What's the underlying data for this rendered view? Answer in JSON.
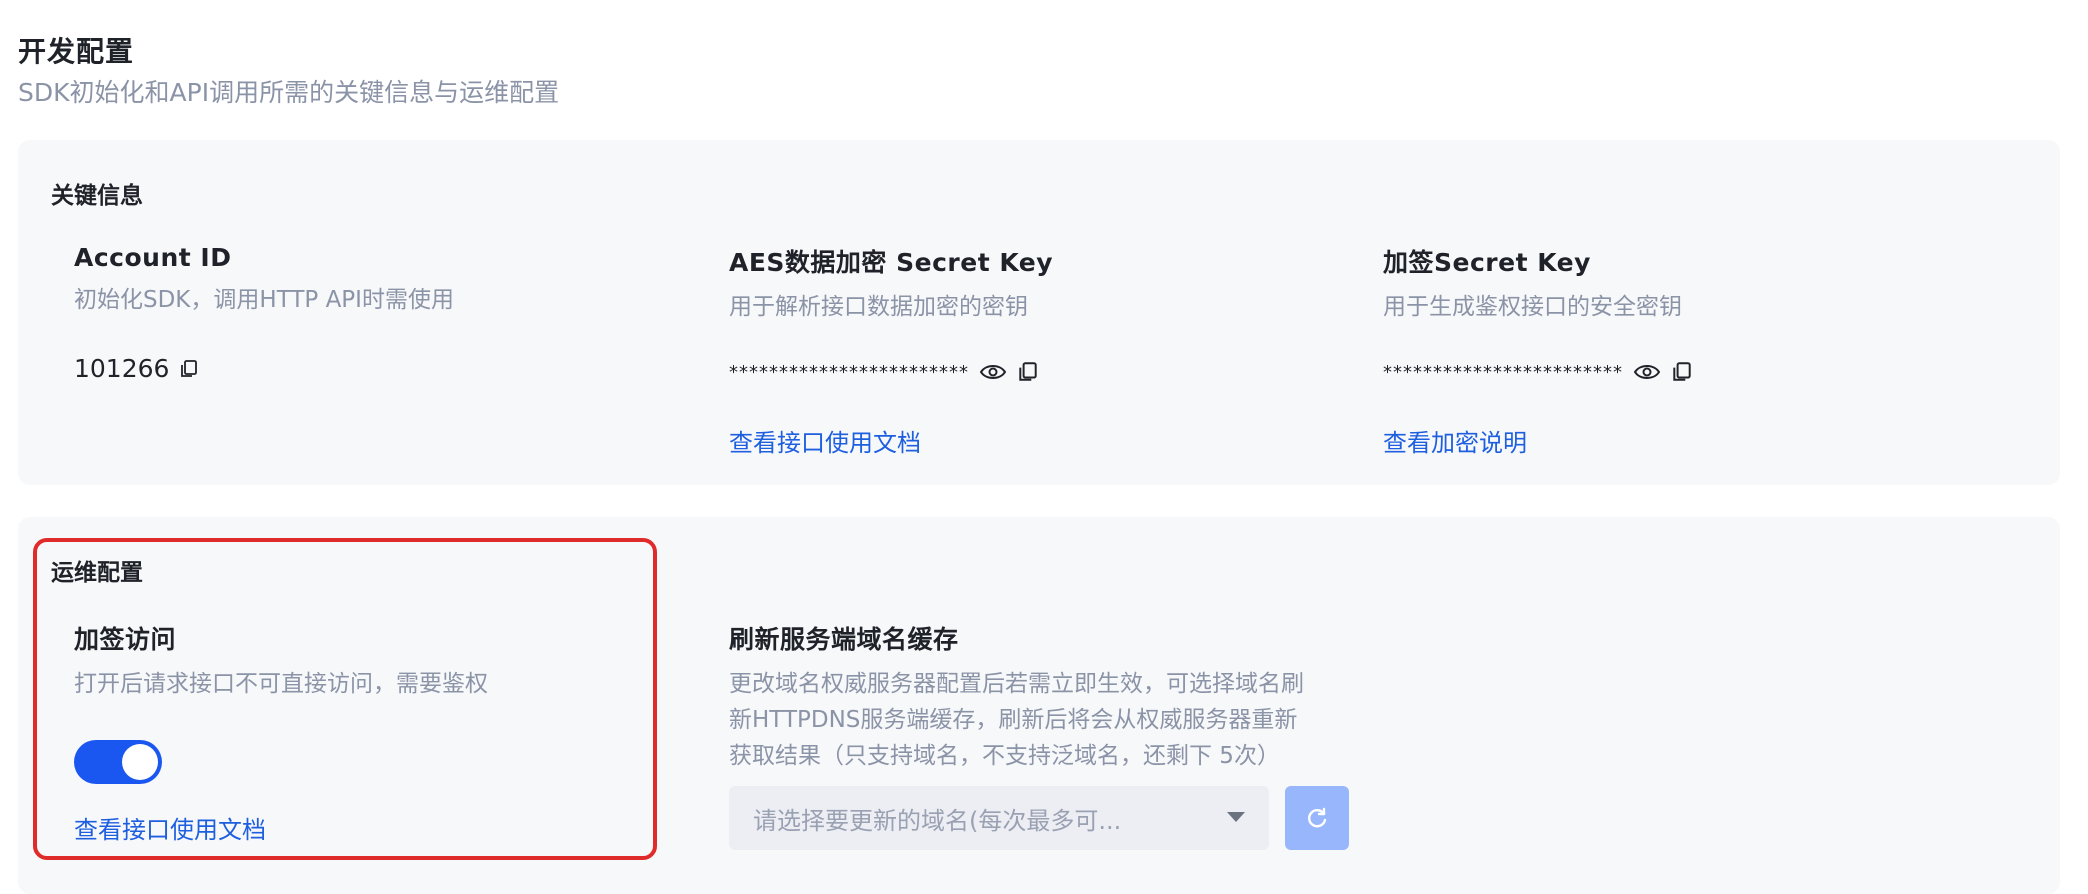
{
  "header": {
    "title": "开发配置",
    "subtitle": "SDK初始化和API调用所需的关键信息与运维配置"
  },
  "key_info": {
    "title": "关键信息",
    "account": {
      "label": "Account ID",
      "desc": "初始化SDK，调用HTTP API时需使用",
      "value": "101266"
    },
    "aes": {
      "label": "AES数据加密 Secret Key",
      "desc": "用于解析接口数据加密的密钥",
      "value": "************************",
      "link": "查看接口使用文档"
    },
    "sign": {
      "label": "加签Secret Key",
      "desc": "用于生成鉴权接口的安全密钥",
      "value": "************************",
      "link": "查看加密说明"
    }
  },
  "ops": {
    "title": "运维配置",
    "signed_access": {
      "label": "加签访问",
      "desc": "打开后请求接口不可直接访问，需要鉴权",
      "enabled": true,
      "link": "查看接口使用文档"
    },
    "refresh_cache": {
      "label": "刷新服务端域名缓存",
      "desc_line1": "更改域名权威服务器配置后若需立即生效，可选择域名刷",
      "desc_line2": "新HTTPDNS服务端缓存，刷新后将会从权威服务器重新",
      "desc_line3": "获取结果（只支持域名，不支持泛域名，还剩下 5次）",
      "select_placeholder": "请选择要更新的域名(每次最多可..."
    }
  },
  "colors": {
    "accent": "#1a56f0",
    "link": "#1e5fe0",
    "highlight": "#e02b2b",
    "muted_text": "#8b93a7",
    "card_bg": "#f7f8fa"
  },
  "icons": {
    "copy": "copy-icon",
    "eye": "eye-icon",
    "caret": "caret-down-icon",
    "refresh": "refresh-icon"
  }
}
